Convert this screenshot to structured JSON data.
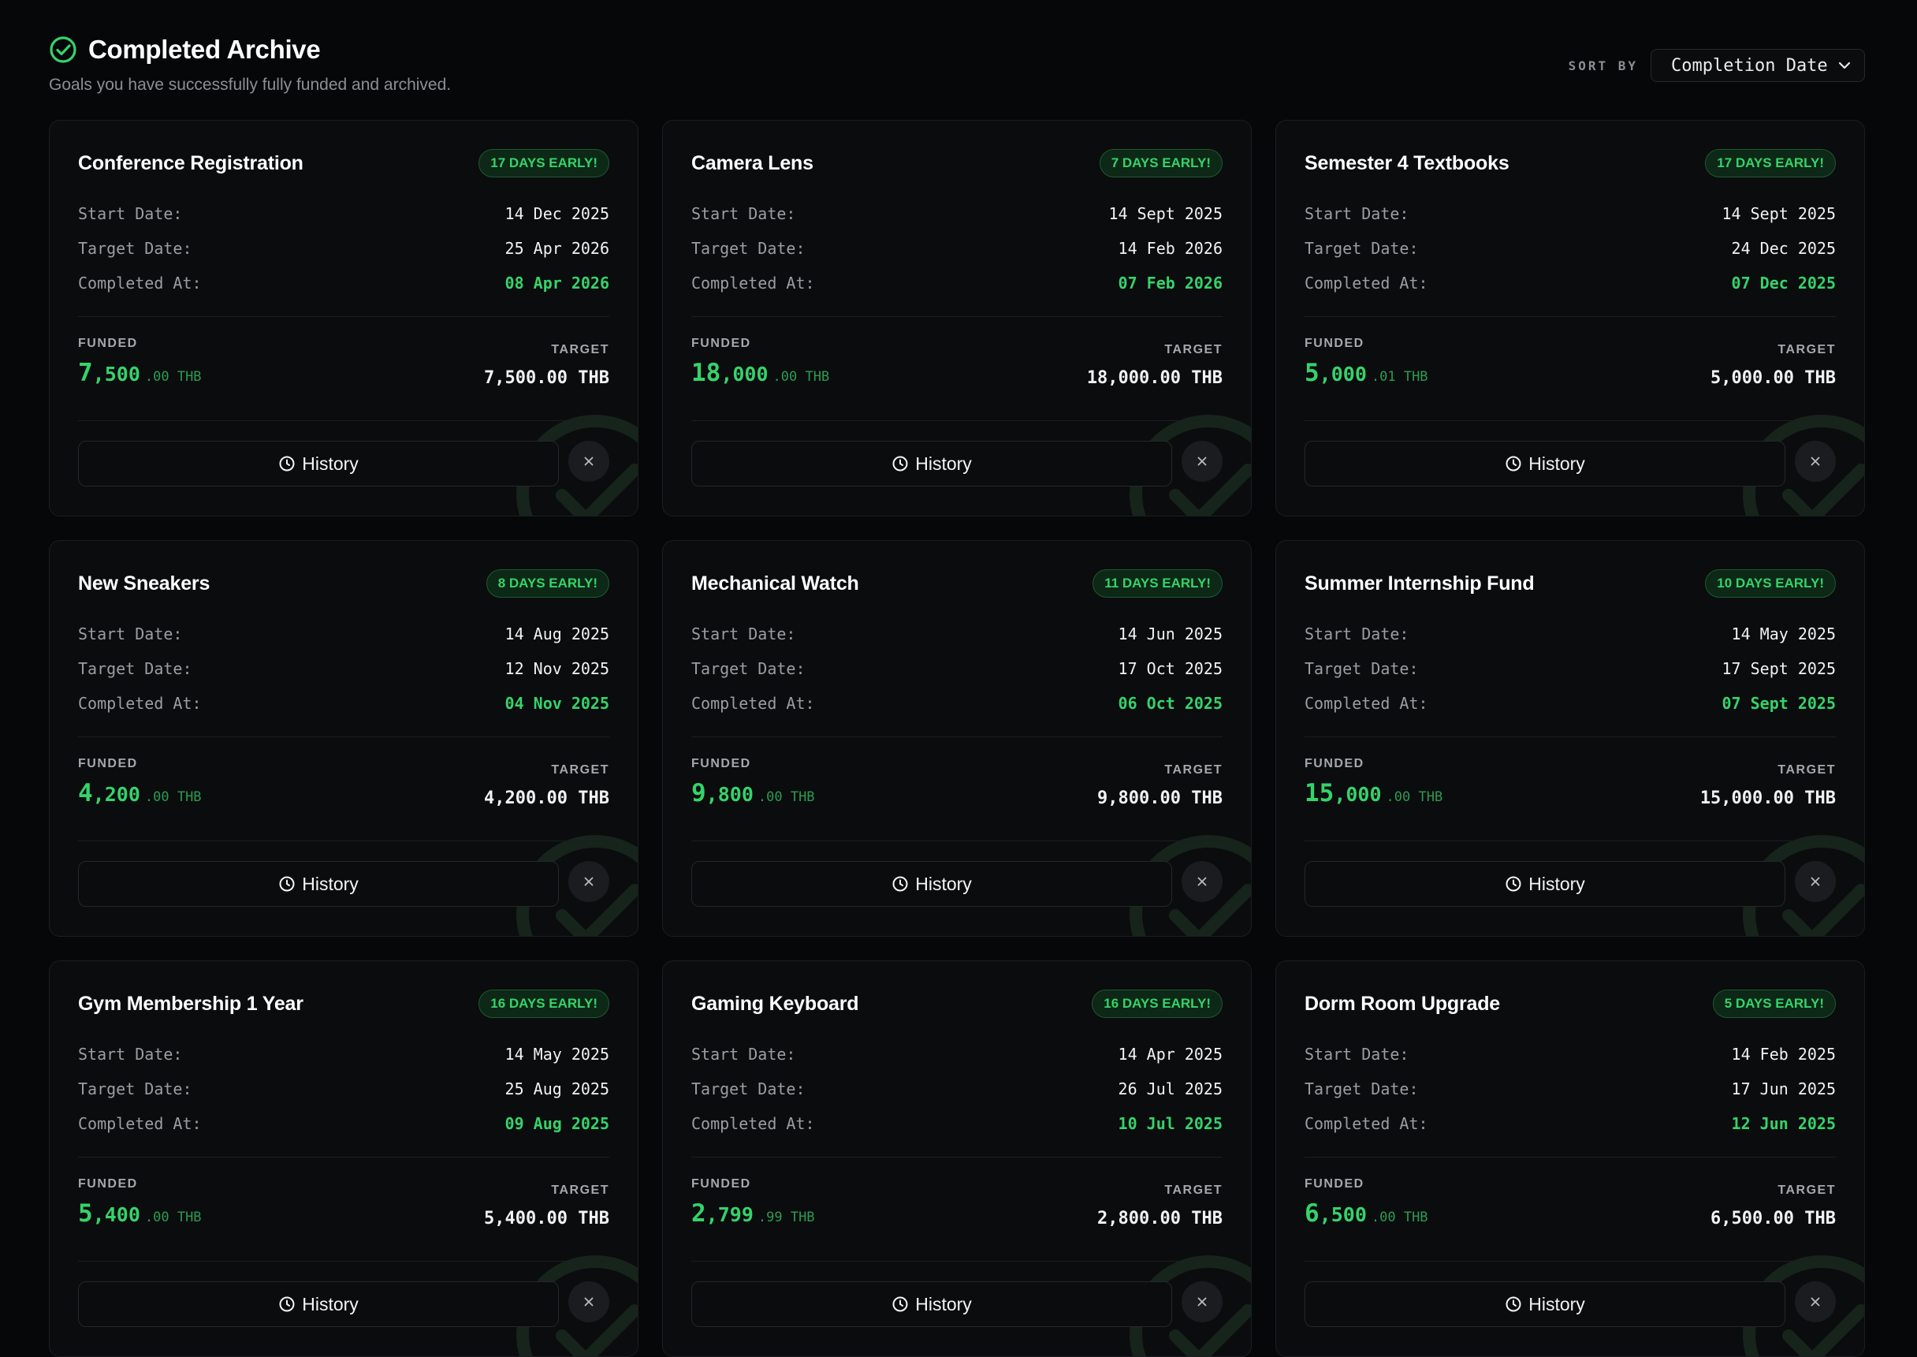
{
  "header": {
    "title": "Completed Archive",
    "subtitle": "Goals you have successfully fully funded and archived.",
    "icon": "check-circle-icon",
    "sort_label": "SORT BY",
    "sort_value": "Completion Date"
  },
  "labels": {
    "start": "Start Date:",
    "target": "Target Date:",
    "completed": "Completed At:",
    "funded": "FUNDED",
    "target_amount": "TARGET",
    "history": "History"
  },
  "colors": {
    "accent": "#35d36a",
    "background": "#060708",
    "card": "#0b0c0e"
  },
  "goals": [
    {
      "title": "Conference Registration",
      "badge": "17 DAYS EARLY!",
      "start": "14 Dec 2025",
      "target_date": "25 Apr 2026",
      "completed": "08 Apr 2026",
      "funded_big": "7",
      "funded_rest": ",500",
      "funded_small": ".00 THB",
      "target_amount": "7,500.00 THB"
    },
    {
      "title": "Camera Lens",
      "badge": "7 DAYS EARLY!",
      "start": "14 Sept 2025",
      "target_date": "14 Feb 2026",
      "completed": "07 Feb 2026",
      "funded_big": "18",
      "funded_rest": ",000",
      "funded_small": ".00 THB",
      "target_amount": "18,000.00 THB"
    },
    {
      "title": "Semester 4 Textbooks",
      "badge": "17 DAYS EARLY!",
      "start": "14 Sept 2025",
      "target_date": "24 Dec 2025",
      "completed": "07 Dec 2025",
      "funded_big": "5",
      "funded_rest": ",000",
      "funded_small": ".01 THB",
      "target_amount": "5,000.00 THB"
    },
    {
      "title": "New Sneakers",
      "badge": "8 DAYS EARLY!",
      "start": "14 Aug 2025",
      "target_date": "12 Nov 2025",
      "completed": "04 Nov 2025",
      "funded_big": "4",
      "funded_rest": ",200",
      "funded_small": ".00 THB",
      "target_amount": "4,200.00 THB"
    },
    {
      "title": "Mechanical Watch",
      "badge": "11 DAYS EARLY!",
      "start": "14 Jun 2025",
      "target_date": "17 Oct 2025",
      "completed": "06 Oct 2025",
      "funded_big": "9",
      "funded_rest": ",800",
      "funded_small": ".00 THB",
      "target_amount": "9,800.00 THB"
    },
    {
      "title": "Summer Internship Fund",
      "badge": "10 DAYS EARLY!",
      "start": "14 May 2025",
      "target_date": "17 Sept 2025",
      "completed": "07 Sept 2025",
      "funded_big": "15",
      "funded_rest": ",000",
      "funded_small": ".00 THB",
      "target_amount": "15,000.00 THB"
    },
    {
      "title": "Gym Membership 1 Year",
      "badge": "16 DAYS EARLY!",
      "start": "14 May 2025",
      "target_date": "25 Aug 2025",
      "completed": "09 Aug 2025",
      "funded_big": "5",
      "funded_rest": ",400",
      "funded_small": ".00 THB",
      "target_amount": "5,400.00 THB"
    },
    {
      "title": "Gaming Keyboard",
      "badge": "16 DAYS EARLY!",
      "start": "14 Apr 2025",
      "target_date": "26 Jul 2025",
      "completed": "10 Jul 2025",
      "funded_big": "2",
      "funded_rest": ",799",
      "funded_small": ".99 THB",
      "target_amount": "2,800.00 THB"
    },
    {
      "title": "Dorm Room Upgrade",
      "badge": "5 DAYS EARLY!",
      "start": "14 Feb 2025",
      "target_date": "17 Jun 2025",
      "completed": "12 Jun 2025",
      "funded_big": "6",
      "funded_rest": ",500",
      "funded_small": ".00 THB",
      "target_amount": "6,500.00 THB"
    }
  ]
}
